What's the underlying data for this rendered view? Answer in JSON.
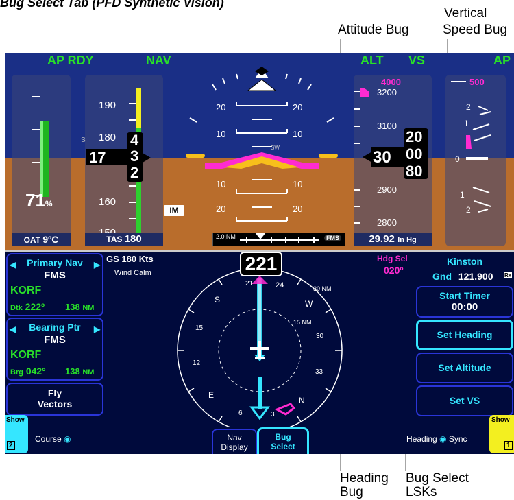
{
  "page_title": "Bug Select Tab (PFD Synthetic Vision)",
  "callouts": {
    "attitude_bug": "Attitude Bug",
    "vertical_speed_bug_line1": "Vertical",
    "vertical_speed_bug_line2": "Speed Bug",
    "heading_bug_line1": "Heading",
    "heading_bug_line2": "Bug",
    "bug_select_lsks_line1": "Bug Select",
    "bug_select_lsks_line2": "LSKs"
  },
  "annunciators": {
    "ap_rdy": "AP RDY",
    "nav": "NAV",
    "alt": "ALT",
    "vs": "VS",
    "ap": "AP"
  },
  "engine": {
    "percent": "71",
    "percent_unit": "%",
    "oat_label": "OAT",
    "oat_value": "9ºC"
  },
  "airspeed": {
    "ticks": [
      "190",
      "180",
      "160",
      "150"
    ],
    "current_big": "17",
    "current_roll_top": "4",
    "current_roll_mid": "3",
    "current_roll_bot": "2",
    "s_marker": "S",
    "tas_label": "TAS",
    "tas_value": "180"
  },
  "attitude": {
    "pitch_marks": [
      "20",
      "20",
      "10",
      "10",
      "10",
      "10",
      "20",
      "20"
    ],
    "im_label": "IM",
    "sw_label": "SW"
  },
  "altitude": {
    "bug_value": "4000",
    "ticks": [
      "3200",
      "3100",
      "2900",
      "2800"
    ],
    "current_big": "30",
    "current_roll_top": "20",
    "current_roll_mid": "00",
    "current_roll_bot": "80",
    "baro_value": "29.92",
    "baro_unit": "In Hg"
  },
  "vsi": {
    "bug_value": "500",
    "marks": [
      "2",
      "1",
      "0",
      "1",
      "2"
    ]
  },
  "scale": {
    "range_label": "2.0|NM",
    "source_label": "FMS"
  },
  "nav_display": {
    "gs_label": "GS",
    "gs_value": "180",
    "gs_unit": "Kts",
    "wind": "Wind Calm",
    "heading_value": "221",
    "hdg_sel_label": "Hdg Sel",
    "hdg_sel_value": "020º",
    "compass_labels": [
      "21",
      "24",
      "W",
      "30",
      "33",
      "N",
      "3",
      "6",
      "E",
      "12",
      "15",
      "S"
    ],
    "range_30": "30 NM",
    "range_15": "15 NM"
  },
  "left_panel": {
    "primary_nav_label": "Primary Nav",
    "primary_nav_source": "FMS",
    "primary_wpt": "KORF",
    "dtk_label": "Dtk",
    "dtk_value": "222º",
    "dtk_dist": "138",
    "dist_unit": "NM",
    "bearing_label": "Bearing Ptr",
    "bearing_source": "FMS",
    "bearing_wpt": "KORF",
    "brg_label": "Brg",
    "brg_value": "042º",
    "brg_dist": "138",
    "fly_vectors_line1": "Fly",
    "fly_vectors_line2": "Vectors",
    "show_label": "Show",
    "show_num": "2",
    "course_label": "Course"
  },
  "right_panel": {
    "freq_name": "Kinston",
    "freq_type": "Gnd",
    "freq_value": "121.900",
    "rx": "Rx",
    "start_timer": "Start Timer",
    "timer_value": "00:00",
    "set_heading": "Set Heading",
    "set_altitude": "Set Altitude",
    "set_vs": "Set VS",
    "show_label": "Show",
    "show_num": "1",
    "heading_label": "Heading",
    "sync_label": "Sync"
  },
  "tabs": {
    "nav_display_line1": "Nav",
    "nav_display_line2": "Display",
    "bug_select_line1": "Bug",
    "bug_select_line2": "Select"
  }
}
